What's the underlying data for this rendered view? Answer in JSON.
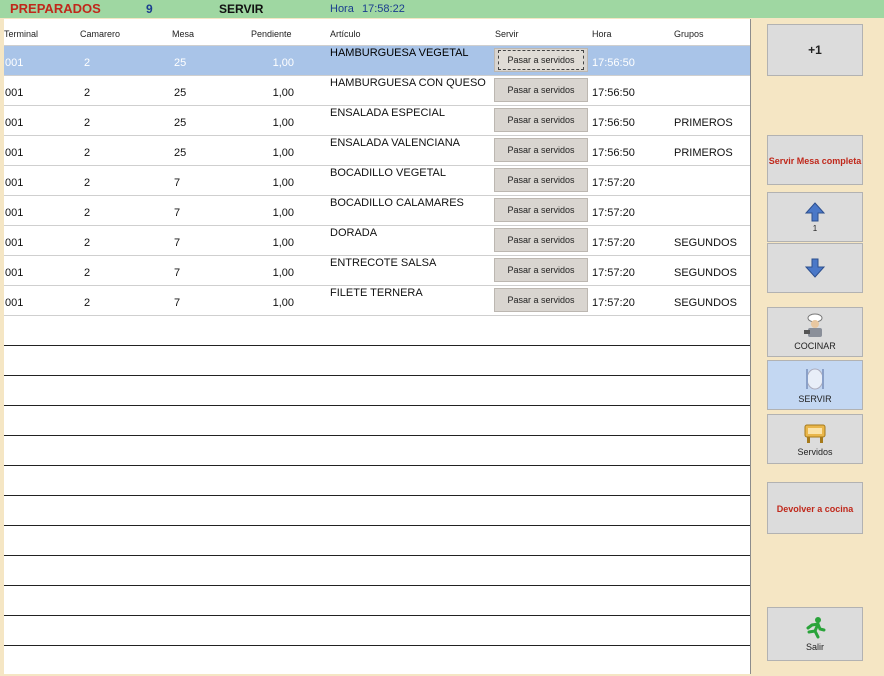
{
  "topbar": {
    "section": "PREPARADOS",
    "count": "9",
    "mode": "SERVIR",
    "hora_label": "Hora",
    "hora_value": "17:58:22"
  },
  "columns": [
    "Terminal",
    "Camarero",
    "Mesa",
    "Pendiente",
    "Artículo",
    "Servir",
    "Hora",
    "Grupos"
  ],
  "rows": [
    {
      "terminal": "001",
      "camarero": "2",
      "mesa": "25",
      "pendiente": "1,00",
      "articulo": "HAMBURGUESA VEGETAL",
      "servir": "Pasar a servidos",
      "hora": "17:56:50",
      "grupo": ""
    },
    {
      "terminal": "001",
      "camarero": "2",
      "mesa": "25",
      "pendiente": "1,00",
      "articulo": "HAMBURGUESA CON QUESO",
      "servir": "Pasar a servidos",
      "hora": "17:56:50",
      "grupo": ""
    },
    {
      "terminal": "001",
      "camarero": "2",
      "mesa": "25",
      "pendiente": "1,00",
      "articulo": "ENSALADA ESPECIAL",
      "servir": "Pasar a servidos",
      "hora": "17:56:50",
      "grupo": "PRIMEROS"
    },
    {
      "terminal": "001",
      "camarero": "2",
      "mesa": "25",
      "pendiente": "1,00",
      "articulo": "ENSALADA VALENCIANA",
      "servir": "Pasar a servidos",
      "hora": "17:56:50",
      "grupo": "PRIMEROS"
    },
    {
      "terminal": "001",
      "camarero": "2",
      "mesa": "7",
      "pendiente": "1,00",
      "articulo": "BOCADILLO VEGETAL",
      "servir": "Pasar a servidos",
      "hora": "17:57:20",
      "grupo": ""
    },
    {
      "terminal": "001",
      "camarero": "2",
      "mesa": "7",
      "pendiente": "1,00",
      "articulo": "BOCADILLO CALAMARES",
      "servir": "Pasar a servidos",
      "hora": "17:57:20",
      "grupo": ""
    },
    {
      "terminal": "001",
      "camarero": "2",
      "mesa": "7",
      "pendiente": "1,00",
      "articulo": "DORADA",
      "servir": "Pasar a servidos",
      "hora": "17:57:20",
      "grupo": "SEGUNDOS"
    },
    {
      "terminal": "001",
      "camarero": "2",
      "mesa": "7",
      "pendiente": "1,00",
      "articulo": "ENTRECOTE SALSA",
      "servir": "Pasar a servidos",
      "hora": "17:57:20",
      "grupo": "SEGUNDOS"
    },
    {
      "terminal": "001",
      "camarero": "2",
      "mesa": "7",
      "pendiente": "1,00",
      "articulo": "FILETE TERNERA",
      "servir": "Pasar a servidos",
      "hora": "17:57:20",
      "grupo": "SEGUNDOS"
    }
  ],
  "selected_row": 0,
  "side": {
    "plus_one": "+1",
    "servir_mesa": "Servir Mesa completa",
    "page_number": "1",
    "cocinar": "COCINAR",
    "servir": "SERVIR",
    "servidos": "Servidos",
    "devolver": "Devolver a cocina",
    "salir": "Salir"
  },
  "colors": {
    "topbar": "#9fd7a2",
    "background": "#f5e6c4",
    "selected_row": "#a9c4e8",
    "accent_red": "#c0281b"
  }
}
